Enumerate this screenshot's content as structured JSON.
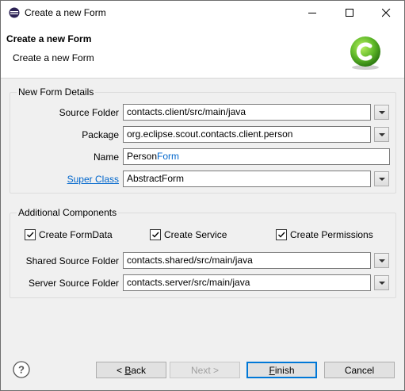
{
  "window": {
    "title": "Create a new Form",
    "minimize_icon": "minimize-icon",
    "maximize_icon": "maximize-icon",
    "close_icon": "close-icon"
  },
  "banner": {
    "heading": "Create a new Form",
    "subtitle": "Create a new Form",
    "logo_icon": "scout-logo-icon"
  },
  "details": {
    "legend": "New Form Details",
    "source_folder_label": "Source Folder",
    "source_folder_value": "contacts.client/src/main/java",
    "package_label": "Package",
    "package_value": "org.eclipse.scout.contacts.client.person",
    "name_label": "Name",
    "name_prefix": "Person",
    "name_suffix": "Form",
    "superclass_label": "Super Class",
    "superclass_value": "AbstractForm"
  },
  "additional": {
    "legend": "Additional Components",
    "create_formdata": "Create FormData",
    "create_service": "Create Service",
    "create_permissions": "Create Permissions",
    "shared_label": "Shared Source Folder",
    "shared_value": "contacts.shared/src/main/java",
    "server_label": "Server Source Folder",
    "server_value": "contacts.server/src/main/java"
  },
  "buttons": {
    "back_mnemonic": "B",
    "back_rest": "ack",
    "back_prefix": "< ",
    "next_label": "Next >",
    "finish_mnemonic": "F",
    "finish_rest": "inish",
    "cancel_label": "Cancel"
  },
  "colors": {
    "link": "#0066cc",
    "name_suffix": "#0066cc",
    "accent": "#0078d7"
  }
}
